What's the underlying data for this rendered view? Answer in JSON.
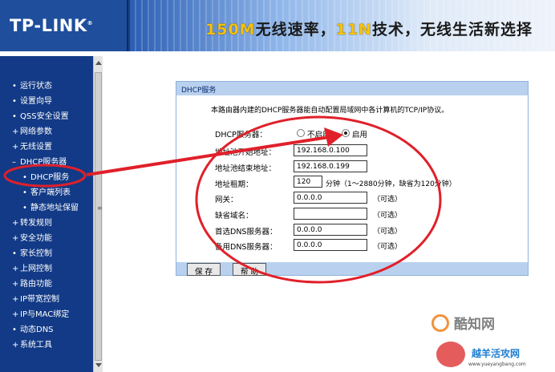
{
  "header": {
    "logo": "TP-LINK",
    "logo_mark": "®",
    "slogan_part1": "150M",
    "slogan_part2": "无线速率，",
    "slogan_part3": "11N",
    "slogan_part4": "技术，无线生活新选择"
  },
  "sidebar": {
    "items": [
      {
        "bullet": "•",
        "label": "运行状态"
      },
      {
        "bullet": "•",
        "label": "设置向导"
      },
      {
        "bullet": "•",
        "label": "QSS安全设置"
      },
      {
        "bullet": "+",
        "label": "网络参数"
      },
      {
        "bullet": "+",
        "label": "无线设置"
      },
      {
        "bullet": "–",
        "label": "DHCP服务器"
      },
      {
        "bullet": "•",
        "label": "DHCP服务",
        "sub": true
      },
      {
        "bullet": "•",
        "label": "客户端列表",
        "sub": true
      },
      {
        "bullet": "•",
        "label": "静态地址保留",
        "sub": true
      },
      {
        "bullet": "+",
        "label": "转发规则"
      },
      {
        "bullet": "+",
        "label": "安全功能"
      },
      {
        "bullet": "•",
        "label": "家长控制"
      },
      {
        "bullet": "+",
        "label": "上网控制"
      },
      {
        "bullet": "+",
        "label": "路由功能"
      },
      {
        "bullet": "+",
        "label": "IP带宽控制"
      },
      {
        "bullet": "+",
        "label": "IP与MAC绑定"
      },
      {
        "bullet": "•",
        "label": "动态DNS"
      },
      {
        "bullet": "+",
        "label": "系统工具"
      }
    ],
    "scroll_grip": "≡"
  },
  "panel": {
    "title": "DHCP服务",
    "description": "本路由器内建的DHCP服务器能自动配置局域网中各计算机的TCP/IP协议。",
    "dhcp_server_label": "DHCP服务器：",
    "radio_disable": "不启用",
    "radio_enable": "启用",
    "selected": "启用",
    "start_ip_label": "地址池开始地址：",
    "start_ip": "192.168.0.100",
    "end_ip_label": "地址池结束地址：",
    "end_ip": "192.168.0.199",
    "lease_label": "地址租期：",
    "lease_value": "120",
    "lease_hint": "分钟（1～2880分钟，缺省为120分钟）",
    "gateway_label": "网关：",
    "gateway_value": "0.0.0.0",
    "domain_label": "缺省域名：",
    "domain_value": "",
    "dns1_label": "首选DNS服务器：",
    "dns1_value": "0.0.0.0",
    "dns2_label": "备用DNS服务器：",
    "dns2_value": "0.0.0.0",
    "optional": "（可选）",
    "save_button": "保 存",
    "help_button": "帮 助"
  },
  "watermark": {
    "brand": "酷知网",
    "brand2": "越羊活攻网",
    "url": "www.yueyangbang.com"
  },
  "colors": {
    "sidebar_bg": "#123a86",
    "header_bg": "#1a3f86",
    "panel_header": "#b9d1ef",
    "annotation_red": "#e0202a"
  }
}
